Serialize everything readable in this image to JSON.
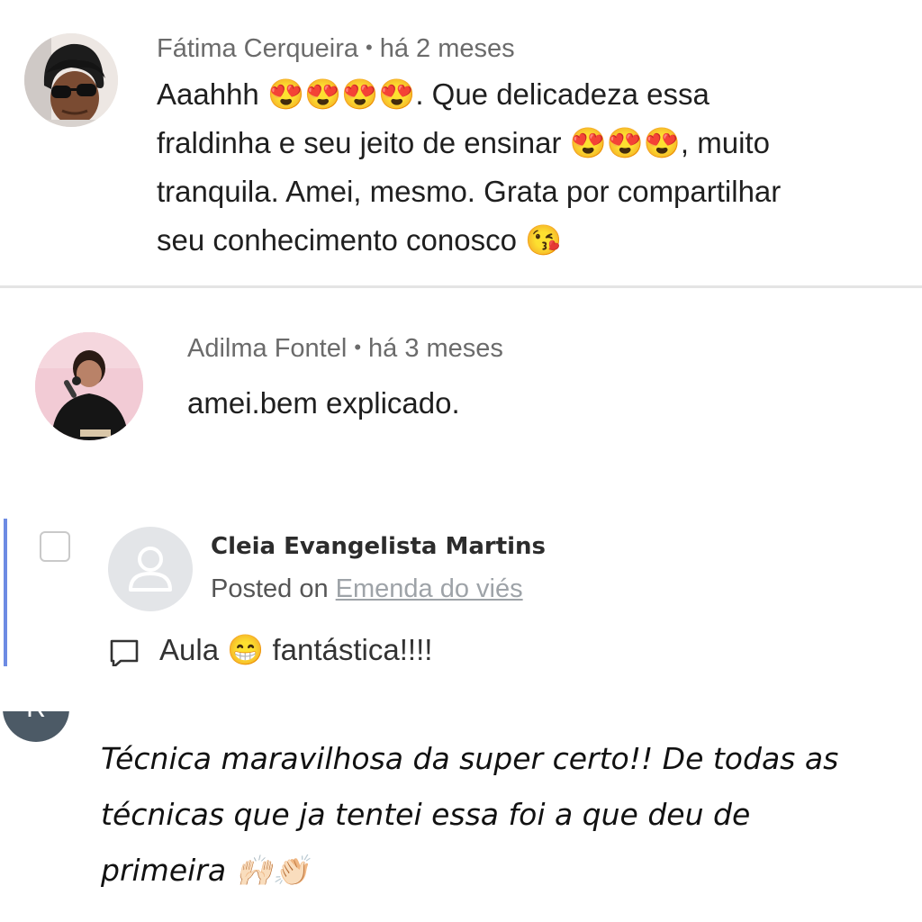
{
  "comments": [
    {
      "author": "Fátima Cerqueira",
      "separator": "•",
      "time": "há 2 meses",
      "lines": [
        {
          "before": "Aaahhh ",
          "emoji": "😍😍😍😍",
          "after": ". Que delicadeza essa"
        },
        {
          "before": "fraldinha e seu jeito de ensinar ",
          "emoji": "😍😍😍",
          "after": ", muito"
        },
        {
          "before": "tranquila. Amei, mesmo. Grata por compartilhar",
          "emoji": "",
          "after": ""
        },
        {
          "before": "seu conhecimento conosco ",
          "emoji": "😘",
          "after": ""
        }
      ]
    },
    {
      "author": "Adilma Fontel",
      "separator": "•",
      "time": "há 3 meses",
      "text": "amei.bem explicado."
    }
  ],
  "card": {
    "author": "Cleia Evangelista Martins",
    "posted_prefix": "Posted on",
    "posted_link": "Emenda do viés",
    "comment_before": "Aula ",
    "comment_emoji": "😁",
    "comment_after": " fantástica!!!!"
  },
  "last_comment": {
    "avatar_initial": "R",
    "lines": [
      {
        "text": "Técnica maravilhosa da super certo!! De todas as",
        "emoji": ""
      },
      {
        "text": "técnicas que ja tentei essa foi a que deu de",
        "emoji": ""
      },
      {
        "text": "primeira ",
        "emoji": "🙌🏻👏🏻"
      }
    ]
  },
  "colors": {
    "accent_bar": "#6d8be3",
    "link": "#9ea3a8",
    "meta_text": "#6b6b6b",
    "avatar_r": "#4c5a66"
  }
}
